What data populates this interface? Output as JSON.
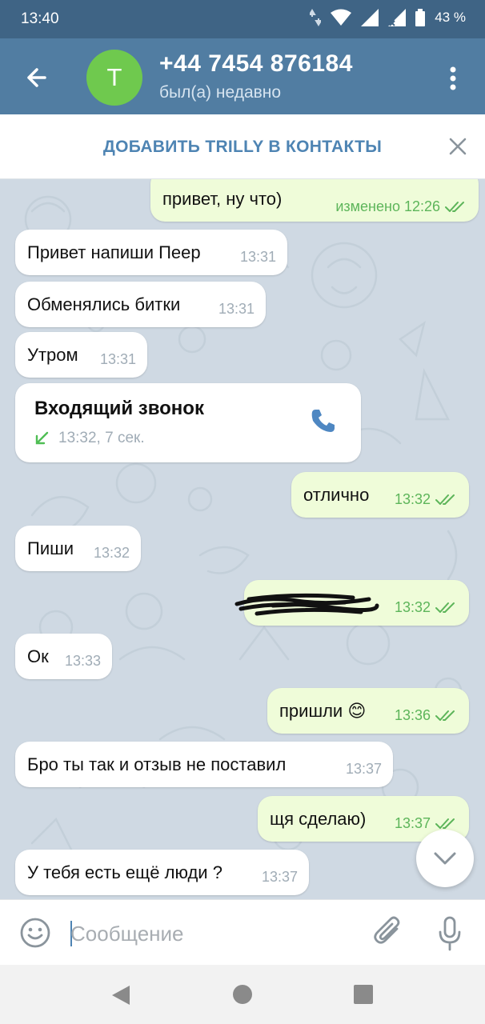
{
  "status_bar": {
    "time": "13:40",
    "battery": "43 %"
  },
  "header": {
    "avatar_letter": "T",
    "contact_name": "+44 7454 876184",
    "contact_status": "был(а) недавно"
  },
  "add_contact": {
    "label": "ДОБАВИТЬ TRILLY В КОНТАКТЫ"
  },
  "messages": [
    {
      "text": "привет, ну что)",
      "time": "изменено 12:26",
      "direction": "out",
      "read": true
    },
    {
      "text": "Привет напиши Пеер",
      "time": "13:31",
      "direction": "in"
    },
    {
      "text": "Обменялись битки",
      "time": "13:31",
      "direction": "in"
    },
    {
      "text": "Утром",
      "time": "13:31",
      "direction": "in"
    },
    {
      "type": "call",
      "title": "Входящий звонок",
      "details": "13:32, 7 сек.",
      "direction": "in"
    },
    {
      "text": "отлично",
      "time": "13:32",
      "direction": "out",
      "read": true
    },
    {
      "text": "Пиши",
      "time": "13:32",
      "direction": "in"
    },
    {
      "text": "",
      "time": "13:32",
      "direction": "out",
      "read": true,
      "redacted": true
    },
    {
      "text": "Ок",
      "time": "13:33",
      "direction": "in"
    },
    {
      "text": "пришли 😊",
      "time": "13:36",
      "direction": "out",
      "read": true
    },
    {
      "text": "Бро ты так и отзыв не поставил",
      "time": "13:37",
      "direction": "in"
    },
    {
      "text": "щя сделаю)",
      "time": "13:37",
      "direction": "out",
      "read": true
    },
    {
      "text": "У тебя есть ещё люди ?",
      "time": "13:37",
      "direction": "in"
    }
  ],
  "composer": {
    "placeholder": "Сообщение"
  },
  "colors": {
    "header": "#517da2",
    "status_bar": "#3f6485",
    "outgoing_bubble": "#effcd9",
    "avatar": "#6fc94e",
    "accent": "#4e84b3"
  },
  "icons": [
    "back-arrow-icon",
    "more-vert-icon",
    "close-icon",
    "phone-icon",
    "missed-arrow-icon",
    "double-check-icon",
    "chevron-down-icon",
    "emoji-icon",
    "attach-icon",
    "mic-icon"
  ]
}
